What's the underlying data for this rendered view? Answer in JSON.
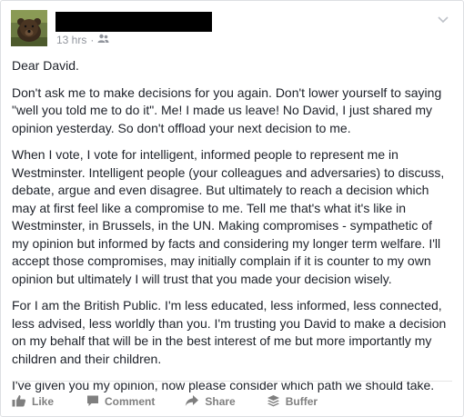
{
  "post": {
    "timestamp": "13 hrs",
    "separator": "·",
    "paragraphs": [
      "Dear David.",
      "Don't ask me to make decisions for you again. Don't lower yourself to saying \"well you told me to do it\". Me! I made us leave! No David, I just shared my opinion yesterday. So don't offload your next decision to me.",
      "When I vote, I vote for intelligent, informed people to represent me in Westminster. Intelligent people (your colleagues and adversaries) to discuss, debate, argue and even disagree. But ultimately to reach a decision which may at first feel like a compromise to me. Tell me that's what it's like in Westminster, in Brussels, in the UN. Making compromises - sympathetic of my opinion but informed by facts and considering my longer term welfare. I'll accept those compromises, may initially complain if it is counter to my own opinion but ultimately I will trust that you made your decision wisely.",
      "For I am the British Public. I'm less educated, less informed, less connected, less advised, less worldly than you. I'm trusting you David to make a decision on my behalf that will be in the best interest of me but more importantly my children and their children.",
      "I've given you my opinion, now please consider which path we should take."
    ]
  },
  "actions": {
    "like": "Like",
    "comment": "Comment",
    "share": "Share",
    "buffer": "Buffer"
  },
  "icons": {
    "audience": "friends-icon",
    "menu": "chevron-down-icon"
  }
}
